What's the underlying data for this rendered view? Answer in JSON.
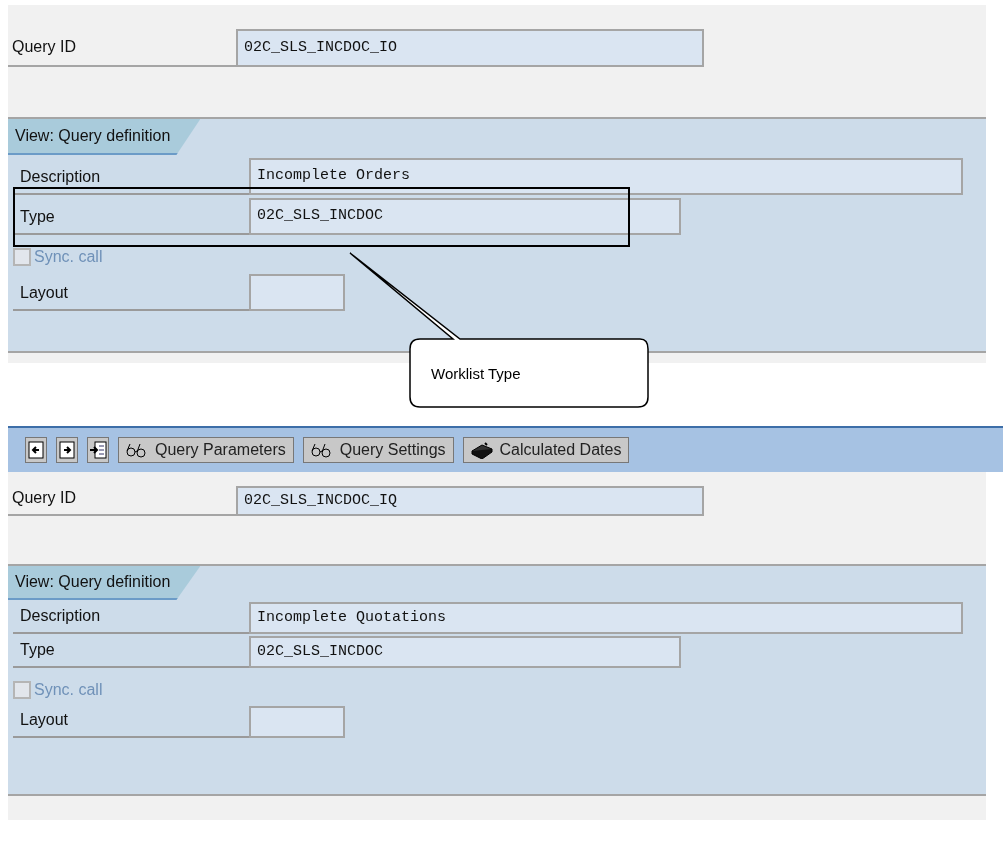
{
  "screens": [
    {
      "query_id": {
        "label": "Query ID",
        "value": "02C_SLS_INCDOC_IO"
      },
      "view": {
        "tab": "View: Query definition",
        "description": {
          "label": "Description",
          "value": "Incomplete Orders"
        },
        "type": {
          "label": "Type",
          "value": "02C_SLS_INCDOC",
          "highlighted": true
        },
        "sync_call": {
          "label": "Sync. call",
          "checked": false,
          "disabled": true
        },
        "layout": {
          "label": "Layout"
        }
      }
    },
    {
      "toolbar": [
        {
          "kind": "icon"
        },
        {
          "kind": "icon"
        },
        {
          "kind": "icon"
        },
        {
          "kind": "text",
          "label": "Query Parameters"
        },
        {
          "kind": "text",
          "label": "Query Settings"
        },
        {
          "kind": "text",
          "label": "Calculated Dates"
        }
      ],
      "query_id": {
        "label": "Query ID",
        "value": "02C_SLS_INCDOC_IQ"
      },
      "view": {
        "tab": "View: Query definition",
        "description": {
          "label": "Description",
          "value": "Incomplete Quotations"
        },
        "type": {
          "label": "Type",
          "value": "02C_SLS_INCDOC",
          "highlighted": false
        },
        "sync_call": {
          "label": "Sync. call",
          "checked": false,
          "disabled": true
        },
        "layout": {
          "label": "Layout"
        }
      }
    }
  ],
  "callout": {
    "text": "Worklist Type"
  }
}
